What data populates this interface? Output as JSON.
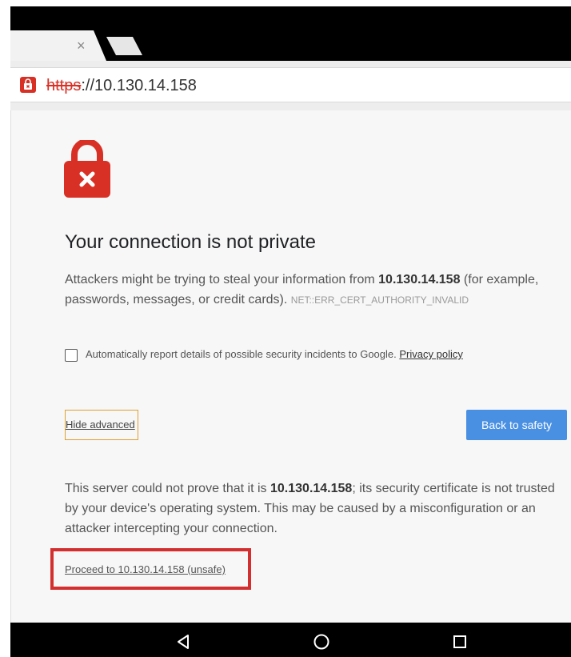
{
  "tab": {
    "close_glyph": "×",
    "new_tab_icon": "new-tab-icon"
  },
  "address_bar": {
    "security_icon": "not-secure-icon",
    "scheme": "https",
    "rest": "://10.130.14.158"
  },
  "page": {
    "title": "Your connection is not private",
    "body_prefix": "Attackers might be trying to steal your information from ",
    "host": "10.130.14.158",
    "body_suffix": " (for example, passwords, messages, or credit cards).",
    "error_code": "NET::ERR_CERT_AUTHORITY_INVALID",
    "checkbox_label": "Automatically report details of possible security incidents to Google.",
    "privacy_link": "Privacy policy",
    "hide_advanced": "Hide advanced",
    "back_to_safety": "Back to safety",
    "detail_prefix": "This server could not prove that it is ",
    "detail_host": "10.130.14.158",
    "detail_suffix": "; its security certificate is not trusted by your device's operating system. This may be caused by a misconfiguration or an attacker intercepting your connection.",
    "proceed_link": "Proceed to 10.130.14.158 (unsafe)"
  },
  "colors": {
    "error_red": "#d93025",
    "button_blue": "#4a90e2",
    "highlight_red": "#d32f2f",
    "focus_orange": "#e0a030"
  },
  "navbar": {
    "back_icon": "back-triangle-icon",
    "home_icon": "home-circle-icon",
    "recents_icon": "recents-square-icon"
  }
}
